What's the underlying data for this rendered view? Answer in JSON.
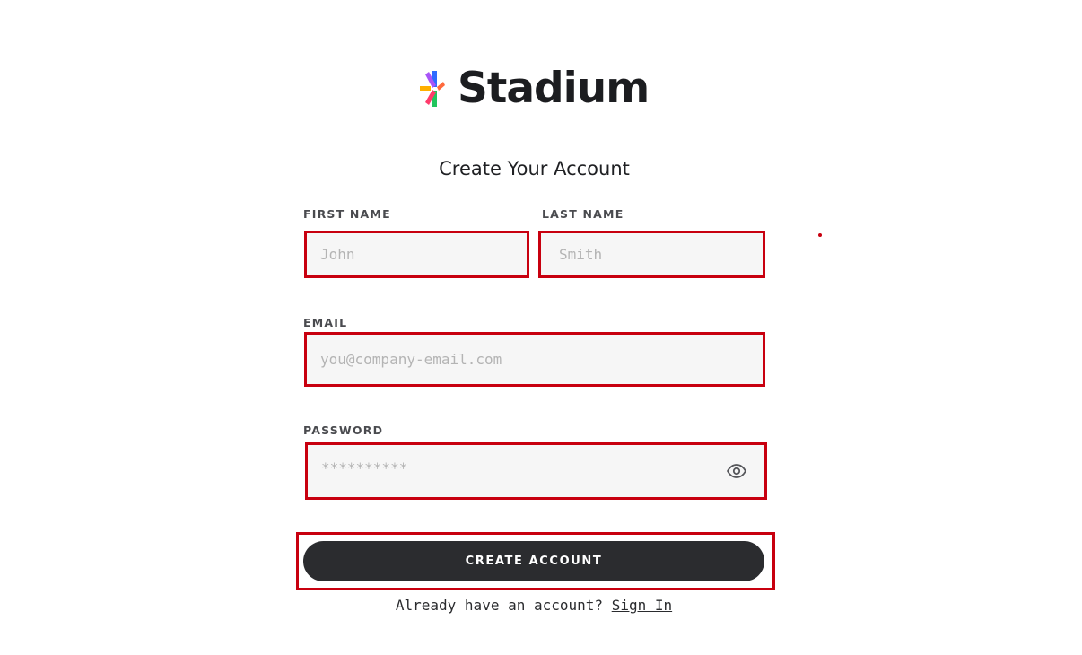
{
  "brand": {
    "name": "Stadium",
    "logo_colors": [
      "#2f6bff",
      "#ff3b6b",
      "#ffb000",
      "#22c55e",
      "#a855f7"
    ]
  },
  "form": {
    "heading": "Create Your Account",
    "first_name": {
      "label": "FIRST NAME",
      "placeholder": "John",
      "value": ""
    },
    "last_name": {
      "label": "LAST NAME",
      "placeholder": "Smith",
      "value": ""
    },
    "email": {
      "label": "EMAIL",
      "placeholder": "you@company-email.com",
      "value": ""
    },
    "password": {
      "label": "PASSWORD",
      "placeholder": "**********",
      "value": "",
      "toggle_icon": "eye-icon"
    },
    "submit_label": "CREATE ACCOUNT"
  },
  "footer": {
    "prompt": "Already have an account?",
    "link_label": "Sign In"
  },
  "colors": {
    "highlight": "#c8000f",
    "button_bg": "#2b2c2f",
    "input_bg": "#f6f6f6"
  }
}
